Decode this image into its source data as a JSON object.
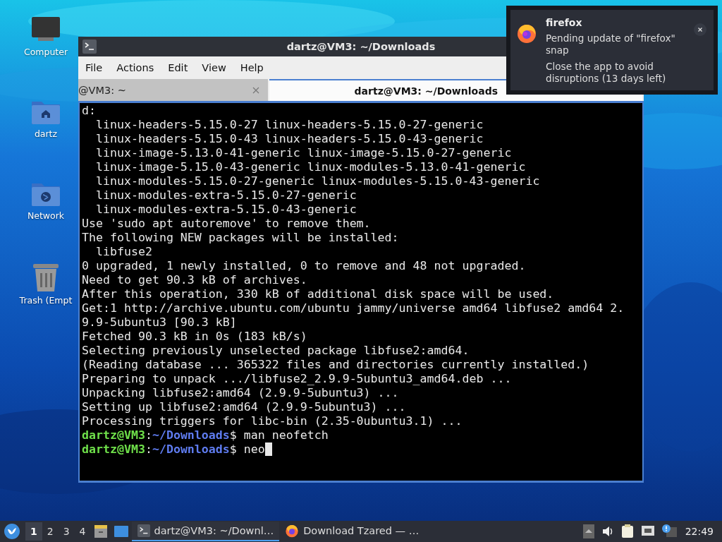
{
  "desktop_icons": [
    {
      "kind": "computer",
      "label": "Computer"
    },
    {
      "kind": "home",
      "label": "dartz"
    },
    {
      "kind": "network",
      "label": "Network"
    },
    {
      "kind": "trash",
      "label": "Trash (Empt"
    }
  ],
  "window": {
    "title": "dartz@VM3: ~/Downloads",
    "menu": [
      "File",
      "Actions",
      "Edit",
      "View",
      "Help"
    ],
    "tabs": [
      {
        "label": "@VM3: ~",
        "selected": false
      },
      {
        "label": "dartz@VM3: ~/Downloads",
        "selected": true
      }
    ],
    "lines": [
      {
        "kind": "text",
        "text": "d:"
      },
      {
        "kind": "text",
        "text": "  linux-headers-5.15.0-27 linux-headers-5.15.0-27-generic"
      },
      {
        "kind": "text",
        "text": "  linux-headers-5.15.0-43 linux-headers-5.15.0-43-generic"
      },
      {
        "kind": "text",
        "text": "  linux-image-5.13.0-41-generic linux-image-5.15.0-27-generic"
      },
      {
        "kind": "text",
        "text": "  linux-image-5.15.0-43-generic linux-modules-5.13.0-41-generic"
      },
      {
        "kind": "text",
        "text": "  linux-modules-5.15.0-27-generic linux-modules-5.15.0-43-generic"
      },
      {
        "kind": "text",
        "text": "  linux-modules-extra-5.15.0-27-generic"
      },
      {
        "kind": "text",
        "text": "  linux-modules-extra-5.15.0-43-generic"
      },
      {
        "kind": "text",
        "text": "Use 'sudo apt autoremove' to remove them."
      },
      {
        "kind": "text",
        "text": "The following NEW packages will be installed:"
      },
      {
        "kind": "text",
        "text": "  libfuse2"
      },
      {
        "kind": "text",
        "text": "0 upgraded, 1 newly installed, 0 to remove and 48 not upgraded."
      },
      {
        "kind": "text",
        "text": "Need to get 90.3 kB of archives."
      },
      {
        "kind": "text",
        "text": "After this operation, 330 kB of additional disk space will be used."
      },
      {
        "kind": "text",
        "text": "Get:1 http://archive.ubuntu.com/ubuntu jammy/universe amd64 libfuse2 amd64 2."
      },
      {
        "kind": "text",
        "text": "9.9-5ubuntu3 [90.3 kB]"
      },
      {
        "kind": "text",
        "text": "Fetched 90.3 kB in 0s (183 kB/s)"
      },
      {
        "kind": "text",
        "text": "Selecting previously unselected package libfuse2:amd64."
      },
      {
        "kind": "text",
        "text": "(Reading database ... 365322 files and directories currently installed.)"
      },
      {
        "kind": "text",
        "text": "Preparing to unpack .../libfuse2_2.9.9-5ubuntu3_amd64.deb ..."
      },
      {
        "kind": "text",
        "text": "Unpacking libfuse2:amd64 (2.9.9-5ubuntu3) ..."
      },
      {
        "kind": "text",
        "text": "Setting up libfuse2:amd64 (2.9.9-5ubuntu3) ..."
      },
      {
        "kind": "text",
        "text": "Processing triggers for libc-bin (2.35-0ubuntu3.1) ..."
      },
      {
        "kind": "prompt",
        "user": "dartz@VM3",
        "sep": ":",
        "path": "~/Downloads",
        "sign": "$",
        "command": "man neofetch",
        "cursor": false
      },
      {
        "kind": "prompt",
        "user": "dartz@VM3",
        "sep": ":",
        "path": "~/Downloads",
        "sign": "$",
        "command": "neo",
        "cursor": true
      }
    ]
  },
  "notification": {
    "app": "firefox",
    "message": "Pending update of \"firefox\" snap",
    "detail": "Close the app to avoid disruptions (13 days left)"
  },
  "taskbar": {
    "workspaces": [
      {
        "label": "1",
        "selected": true
      },
      {
        "label": "2",
        "selected": false
      },
      {
        "label": "3",
        "selected": false
      },
      {
        "label": "4",
        "selected": false
      }
    ],
    "tasks": [
      {
        "kind": "terminal",
        "label": "dartz@VM3: ~/Downl…",
        "selected": true
      },
      {
        "kind": "browser",
        "label": "Download Tzared — …",
        "selected": false
      }
    ],
    "clock": "22:49"
  }
}
